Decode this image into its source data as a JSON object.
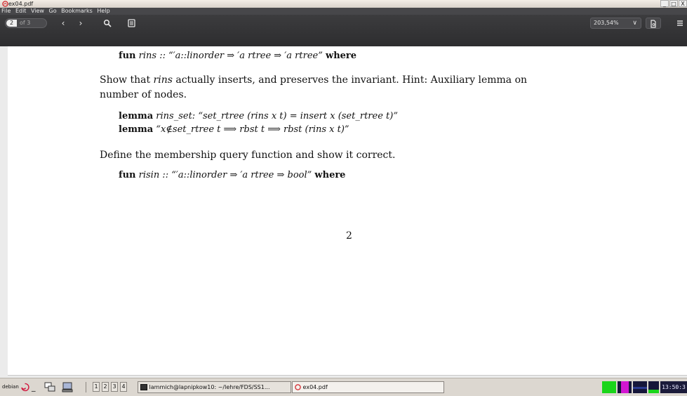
{
  "window": {
    "title": "ex04.pdf",
    "buttons": [
      "_",
      "□",
      "X"
    ]
  },
  "menu": [
    "File",
    "Edit",
    "View",
    "Go",
    "Bookmarks",
    "Help"
  ],
  "toolbar": {
    "page_current": "2",
    "page_total": "of 3",
    "prev_icon": "‹",
    "next_icon": "›",
    "zoom": "203,54%",
    "zoom_chevron": "∨"
  },
  "document": {
    "l1_kw": "fun",
    "l1_rest": "rins :: “′a::linorder ⇒ ′a rtree ⇒ ′a rtree”",
    "l1_where": "where",
    "p1a": "Show that ",
    "p1b": "rins",
    "p1c": " actually inserts, and preserves the invariant. Hint: Auxiliary lemma on",
    "p1d": "number of nodes.",
    "lem1_kw": "lemma",
    "lem1_rest": "rins_set: “set_rtree (rins x t) = insert x (set_rtree t)”",
    "lem2_kw": "lemma",
    "lem2_rest": "“x∉set_rtree t ⟹ rbst t ⟹ rbst (rins x t)”",
    "p2": "Define the membership query function and show it correct.",
    "l2_kw": "fun",
    "l2_rest": "risin :: “′a::linorder ⇒ ′a rtree ⇒ bool”",
    "l2_where": "where",
    "page_number": "2"
  },
  "taskbar": {
    "start": "debian",
    "workspaces": [
      "1",
      "2",
      "3",
      "4"
    ],
    "task_terminal": "lammich@lapnipkow10: ~/lehre/FDS/SS1...",
    "task_pdf": "ex04.pdf",
    "clock": "13:50:3",
    "colors": {
      "monitor_green": "#1ad51a",
      "monitor_navy": "#16163a",
      "monitor_magenta": "#d116d1",
      "monitor_blue": "#2b3a8f"
    }
  }
}
